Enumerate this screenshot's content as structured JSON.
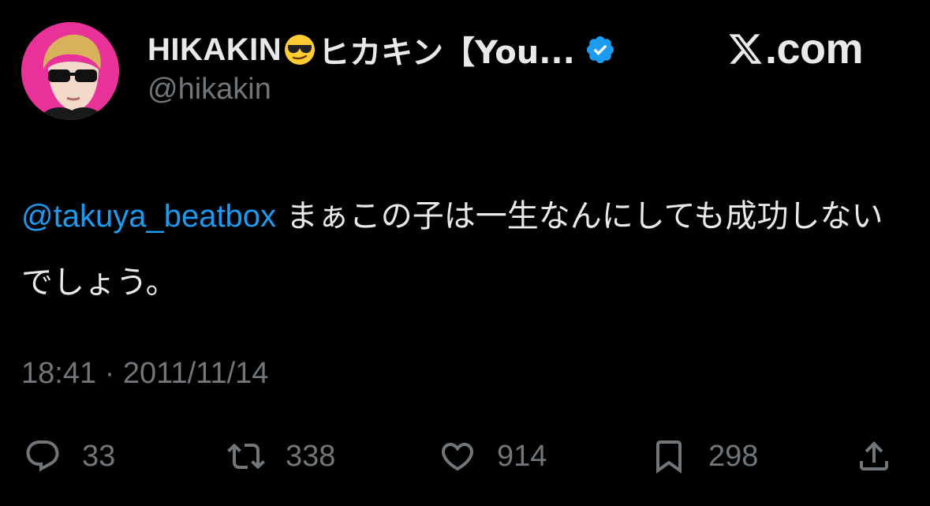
{
  "author": {
    "display_name": "HIKAKIN",
    "display_name_rest": "ヒカキン【You...",
    "handle": "@hikakin",
    "avatar_icon": "avatar-icon",
    "verified_icon": "verified-badge-icon",
    "accent_color": "#1d9bf0",
    "avatar_bg": "#e8329a"
  },
  "branding": {
    "logo_icon": "x-logo-icon",
    "domain": ".com"
  },
  "tweet": {
    "mention": "@takuya_beatbox",
    "text": " まぁこの子は一生なんにしても成功しないでしょう。",
    "timestamp": "18:41 · 2011/11/14"
  },
  "actions": {
    "reply": {
      "icon": "reply-icon",
      "count": "33"
    },
    "retweet": {
      "icon": "retweet-icon",
      "count": "338"
    },
    "like": {
      "icon": "heart-icon",
      "count": "914"
    },
    "bookmark": {
      "icon": "bookmark-icon",
      "count": "298"
    },
    "share": {
      "icon": "share-icon"
    }
  }
}
